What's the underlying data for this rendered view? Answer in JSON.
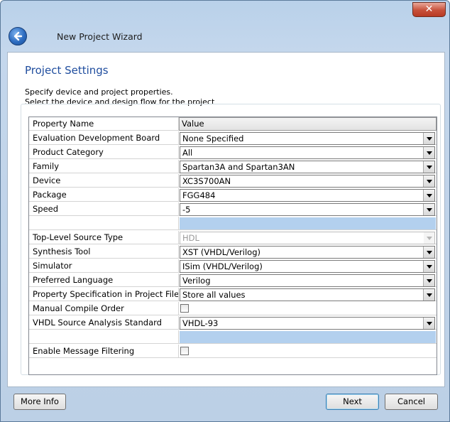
{
  "window": {
    "title": "New Project Wizard",
    "close_label": "✕"
  },
  "page": {
    "title": "Project Settings",
    "description_line1": "Specify device and project properties.",
    "description_line2": "Select the device and design flow for the project"
  },
  "grid": {
    "header_name": "Property Name",
    "header_value": "Value",
    "rows": [
      {
        "name": "Evaluation Development Board",
        "value": "None Specified",
        "kind": "combo"
      },
      {
        "name": "Product Category",
        "value": "All",
        "kind": "combo"
      },
      {
        "name": "Family",
        "value": "Spartan3A and Spartan3AN",
        "kind": "combo"
      },
      {
        "name": "Device",
        "value": "XC3S700AN",
        "kind": "combo"
      },
      {
        "name": "Package",
        "value": "FGG484",
        "kind": "combo"
      },
      {
        "name": "Speed",
        "value": "-5",
        "kind": "combo"
      },
      {
        "name": "",
        "value": "",
        "kind": "separator"
      },
      {
        "name": "Top-Level Source Type",
        "value": "HDL",
        "kind": "combo-disabled"
      },
      {
        "name": "Synthesis Tool",
        "value": "XST (VHDL/Verilog)",
        "kind": "combo"
      },
      {
        "name": "Simulator",
        "value": "ISim (VHDL/Verilog)",
        "kind": "combo"
      },
      {
        "name": "Preferred Language",
        "value": "Verilog",
        "kind": "combo"
      },
      {
        "name": "Property Specification in Project File",
        "value": "Store all values",
        "kind": "combo"
      },
      {
        "name": "Manual Compile Order",
        "value": "",
        "kind": "checkbox"
      },
      {
        "name": "VHDL Source Analysis Standard",
        "value": "VHDL-93",
        "kind": "combo"
      },
      {
        "name": "",
        "value": "",
        "kind": "separator"
      },
      {
        "name": "Enable Message Filtering",
        "value": "",
        "kind": "checkbox"
      }
    ]
  },
  "buttons": {
    "more_info": "More Info",
    "next": "Next",
    "cancel": "Cancel"
  }
}
